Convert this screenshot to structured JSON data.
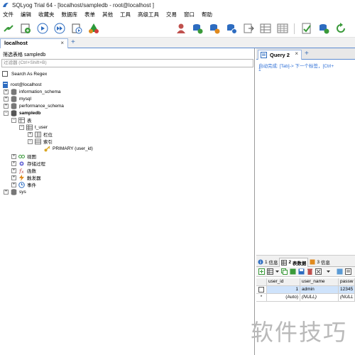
{
  "window": {
    "title": "SQLyog Trial 64 - [localhost/sampledb - root@localhost ]"
  },
  "menu": [
    "文件",
    "编辑",
    "收藏夹",
    "数据库",
    "表单",
    "其他",
    "工具",
    "高级工具",
    "交易",
    "窗口",
    "帮助"
  ],
  "toolbar": {
    "database_select": "sampledb"
  },
  "connection_tab": {
    "label": "localhost",
    "close": "×",
    "add": "+"
  },
  "object_browser": {
    "filter_label": "筛选表格 sampledb",
    "filter_placeholder": "过滤器 (Ctrl+Shift+B)",
    "regex_label": "Search As Regex",
    "root": "root@localhost",
    "databases": [
      "information_schema",
      "mysql",
      "performance_schema",
      "sampledb",
      "sys"
    ],
    "tables_label": "表",
    "table_name": "t_user",
    "columns_label": "栏位",
    "indexes_label": "索引",
    "index_name": "PRIMARY (user_id)",
    "views_label": "视图",
    "procs_label": "存储过程",
    "functions_label": "函数",
    "triggers_label": "触发器",
    "events_label": "事件"
  },
  "query_tab": {
    "label": "Query 2",
    "close": "×",
    "add": "+"
  },
  "editor": {
    "hint": "自动完成: [Tab]-> 下一个标签，[Ctrl+",
    "line_number": "1"
  },
  "results": {
    "tabs": [
      {
        "num": "1",
        "label": "信息"
      },
      {
        "num": "2",
        "label": "表数据"
      },
      {
        "num": "3",
        "label": "信息"
      }
    ],
    "columns": [
      "user_id",
      "user_name",
      "passw"
    ],
    "rows": [
      {
        "marker": "",
        "cells": [
          "1",
          "admin",
          "12345"
        ]
      },
      {
        "marker": "*",
        "cells": [
          "(Auto)",
          "(NULL)",
          "(NULL"
        ]
      }
    ]
  },
  "watermark": "软件技巧",
  "colors": {
    "accent_blue": "#2e6fd6",
    "tab_border": "#9bb7e0",
    "selection": "#cfe3fb"
  }
}
